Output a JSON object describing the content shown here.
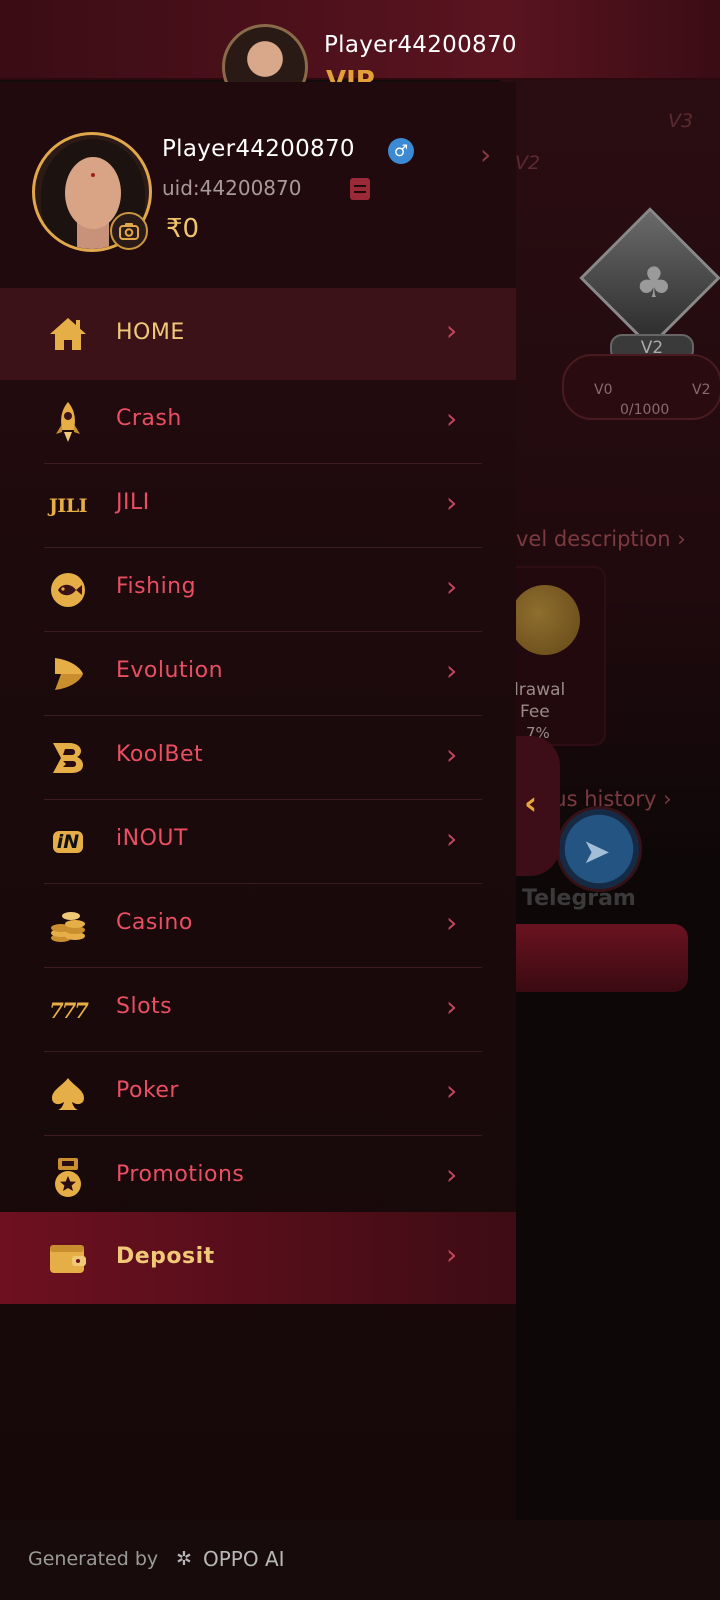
{
  "background": {
    "header_name": "Player44200870",
    "vip_label": "VIP",
    "level_v3": "V3",
    "level_v2": "V2",
    "badge_label": "V2",
    "progress_left": "V0",
    "progress_right": "V2",
    "progress_value": "0/1000",
    "level_description": "vel description",
    "withdrawal": "drawal",
    "fee": "Fee",
    "percent": "7%",
    "bonus_history": "nus history",
    "telegram": "Telegram"
  },
  "profile": {
    "name": "Player44200870",
    "gender_symbol": "♂",
    "uid": "uid:44200870",
    "balance": "₹0"
  },
  "menu": {
    "items": [
      {
        "label": "HOME",
        "icon": "home-icon"
      },
      {
        "label": "Crash",
        "icon": "rocket-icon"
      },
      {
        "label": "JILI",
        "icon": "jili-logo-icon"
      },
      {
        "label": "Fishing",
        "icon": "fish-icon"
      },
      {
        "label": "Evolution",
        "icon": "evolution-logo-icon"
      },
      {
        "label": "KoolBet",
        "icon": "koolbet-logo-icon"
      },
      {
        "label": "iNOUT",
        "icon": "inout-logo-icon"
      },
      {
        "label": "Casino",
        "icon": "coins-icon"
      },
      {
        "label": "Slots",
        "icon": "777-icon"
      },
      {
        "label": "Poker",
        "icon": "spade-icon"
      },
      {
        "label": "Promotions",
        "icon": "medal-icon"
      },
      {
        "label": "Deposit",
        "icon": "wallet-icon"
      }
    ],
    "chevron": "›",
    "jili_text": "JILI",
    "in_text": "iN",
    "seven_text": "777"
  },
  "footer": {
    "generated_by": "Generated by",
    "brand": "OPPO AI"
  },
  "colors": {
    "accent_gold": "#f0c978",
    "menu_label": "#ea4e63",
    "drawer_bg": "#1c0a0c",
    "highlight": "#3c1219"
  }
}
